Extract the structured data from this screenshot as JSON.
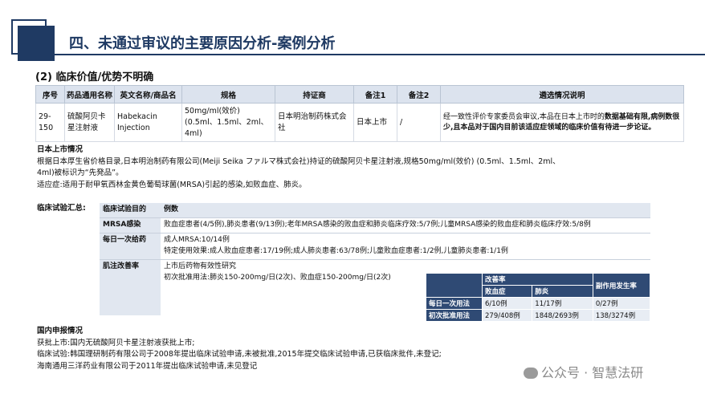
{
  "header": {
    "title": "四、未通过审议的主要原因分析-案例分析"
  },
  "subtitle": "(2) 临床价值/优势不明确",
  "main_table": {
    "columns": [
      "序号",
      "药品通用名称",
      "英文名称/商品名",
      "规格",
      "持证商",
      "备注1",
      "备注2",
      "遴选情况说明"
    ],
    "row": {
      "no": "29-150",
      "generic": "硫酸阿贝卡星注射液",
      "english": "Habekacin Injection",
      "spec": "50mg/ml(效价) (0.5ml、1.5ml、2ml、4ml)",
      "holder": "日本明治制药株式会社",
      "note1": "日本上市",
      "note2": "/",
      "desc_plain": "经一致性评价专家委员会审议,本品在日本上市时的",
      "desc_bold": "数据基础有限,病例数很少,且本品对于国内目前该适应症领域的临床价值有待进一步论证。"
    }
  },
  "japan": {
    "heading": "日本上市情况",
    "line1": "根据日本厚生省价格目录,日本明治制药有限公司(Meiji Seika ファルマ株式会社)持证的硫酸阿贝卡星注射液,规格50mg/ml(效价) (0.5ml、1.5ml、2ml、",
    "line2": "4ml)被标识为“先発品”。",
    "line3": "适应症:适用于耐甲氧西林金黄色葡萄球菌(MRSA)引起的感染,如败血症、肺炎。"
  },
  "trial": {
    "heading": "临床试验汇总:",
    "col_purpose": "临床试验目的",
    "col_cases": "例数",
    "rows": [
      {
        "label": "MRSA感染",
        "lines": [
          "败血症患者(4/5例),肺炎患者(9/13例);老年MRSA感染的败血症和肺炎临床疗效:5/7例;儿童MRSA感染的败血症和肺炎临床疗效:5/8例"
        ]
      },
      {
        "label": "每日一次给药",
        "lines": [
          "成人MRSA:10/14例",
          "特定使用效果:成人败血症患者:17/19例;成人肺炎患者:63/78例;儿童败血症患者:1/2例,儿童肺炎患者:1/1例"
        ]
      },
      {
        "label": "肌注改善率",
        "lines": [
          "上市后药物有效性研究",
          "初次批准用法:肺炎150-200mg/日(2次)、败血症150-200mg/日(2次)"
        ]
      }
    ]
  },
  "results": {
    "h_improve": "改善率",
    "h_side": "副作用发生率",
    "h_sepsis": "败血症",
    "h_pneu": "肺炎",
    "rows": [
      {
        "label": "每日一次用法",
        "sepsis": "6/10例",
        "pneu": "11/17例",
        "side": "0/27例"
      },
      {
        "label": "初次批准用法",
        "sepsis": "279/408例",
        "pneu": "1848/2693例",
        "side": "138/3274例"
      }
    ]
  },
  "domestic": {
    "heading": "国内申报情况",
    "lines": [
      "获批上市:国内无硫酸阿贝卡星注射液获批上市;",
      "临床试验:韩国理研制药有限公司于2008年提出临床试验申请,未被批准,2015年提交临床试验申请,已获临床批件,未登记;",
      "海南通用三洋药业有限公司于2011年提出临床试验申请,未见登记"
    ]
  },
  "watermark": "公众号 · 智慧法研"
}
